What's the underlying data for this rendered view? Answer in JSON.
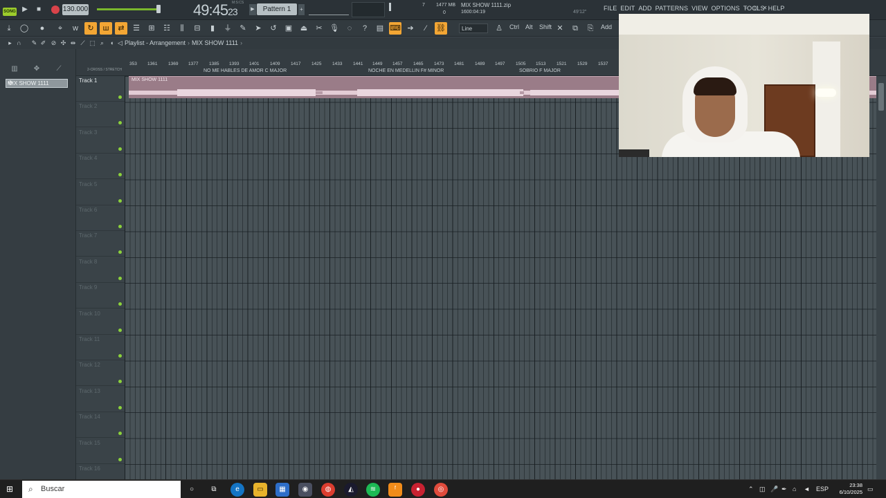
{
  "transport": {
    "mode_badge": "SONG",
    "tempo": "130.000",
    "time_main": "49:45",
    "time_small": "23",
    "time_label": "M:S:CS",
    "pattern_name": "Pattern 1"
  },
  "cpu": {
    "value": "7",
    "memory": "1477 MB",
    "zero": "0"
  },
  "hint": {
    "title": "MIX SHOW 1111.zip",
    "sub": "1600:04:19",
    "time": "49'12\""
  },
  "menu": [
    "FILE",
    "EDIT",
    "ADD",
    "PATTERNS",
    "VIEW",
    "OPTIONS",
    "TOOLS",
    "HELP"
  ],
  "toolbar": {
    "line_mode": "Line",
    "keys": [
      "Ctrl",
      "Alt",
      "Shift"
    ],
    "add_label": "Add"
  },
  "playlist": {
    "title": "Playlist - Arrangement",
    "arrangement": "MIX SHOW 1111",
    "ruler_ctrl": "2-CROSS / STRETCH",
    "bars": [
      "353",
      "1361",
      "1369",
      "1377",
      "1385",
      "1393",
      "1401",
      "1409",
      "1417",
      "1425",
      "1433",
      "1441",
      "1449",
      "1457",
      "1465",
      "1473",
      "1481",
      "1489",
      "1497",
      "1505",
      "1513",
      "1521",
      "1529",
      "1537"
    ],
    "markers": [
      "NO ME HABLES DE AMOR C MAJOR",
      "NOCHE EN MEDELLIN F# MINOR",
      "SOBRIO F MAJOR"
    ]
  },
  "picker": {
    "pattern_item": "MIX SHOW 1111"
  },
  "tracks": [
    "Track 1",
    "Track 2",
    "Track 3",
    "Track 4",
    "Track 5",
    "Track 6",
    "Track 7",
    "Track 8",
    "Track 9",
    "Track 10",
    "Track 11",
    "Track 12",
    "Track 13",
    "Track 14",
    "Track 15",
    "Track 16"
  ],
  "clip": {
    "label": "MIX SHOW 1111"
  },
  "taskbar": {
    "search_placeholder": "Buscar",
    "language": "ESP",
    "time": "23:38",
    "date": "6/10/2025"
  },
  "colors": {
    "accent_orange": "#f3a634",
    "led_green": "#8bd13b",
    "clip_pink": "#9a7c88"
  }
}
